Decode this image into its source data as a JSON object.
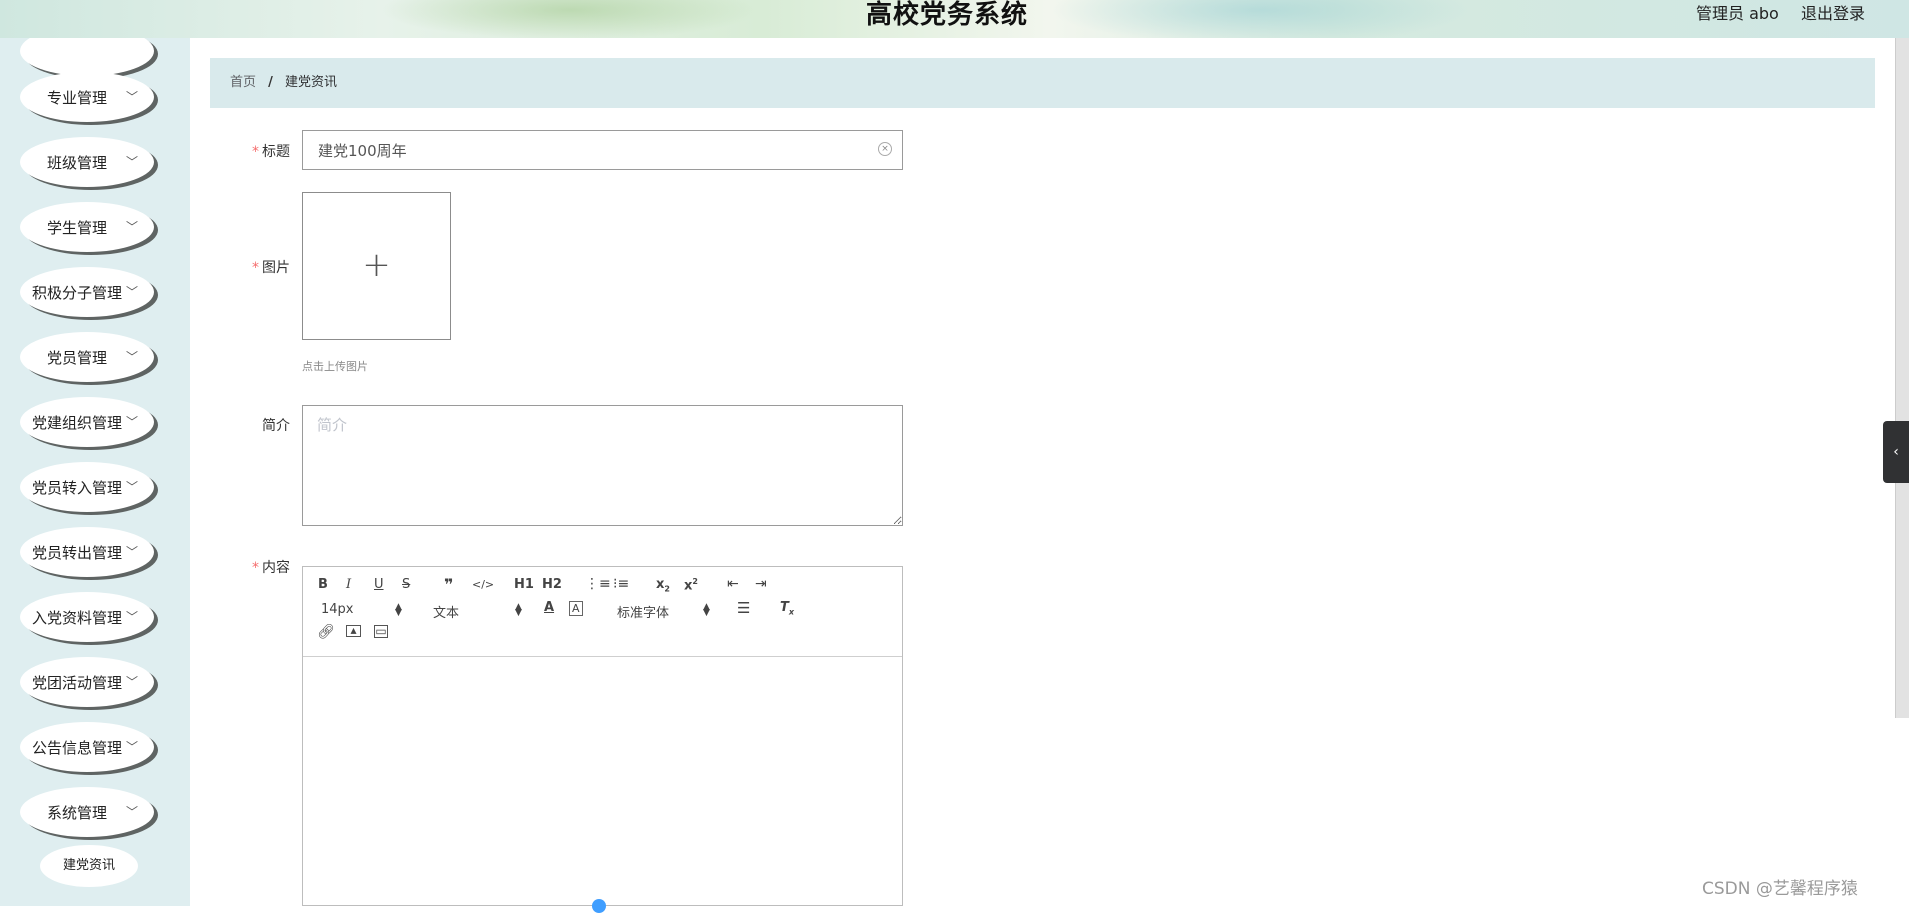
{
  "header": {
    "title": "高校党务系统",
    "user": "管理员 abo",
    "logout": "退出登录"
  },
  "sidebar": {
    "items": [
      {
        "label": "专业管理",
        "chevron": true
      },
      {
        "label": "班级管理",
        "chevron": true
      },
      {
        "label": "学生管理",
        "chevron": true
      },
      {
        "label": "积极分子管理",
        "chevron": true
      },
      {
        "label": "党员管理",
        "chevron": true
      },
      {
        "label": "党建组织管理",
        "chevron": true
      },
      {
        "label": "党员转入管理",
        "chevron": true
      },
      {
        "label": "党员转出管理",
        "chevron": true
      },
      {
        "label": "入党资料管理",
        "chevron": true
      },
      {
        "label": "党团活动管理",
        "chevron": true
      },
      {
        "label": "公告信息管理",
        "chevron": true
      },
      {
        "label": "系统管理",
        "chevron": true
      }
    ],
    "submenu_active": "建党资讯"
  },
  "breadcrumb": {
    "home": "首页",
    "separator": "/",
    "current": "建党资讯"
  },
  "form": {
    "title_label": "标题",
    "title_value": "建党100周年",
    "image_label": "图片",
    "upload_tip": "点击上传图片",
    "intro_label": "简介",
    "intro_placeholder": "简介",
    "content_label": "内容"
  },
  "editor": {
    "font_size": "14px",
    "header_select": "文本",
    "font_family": "标准字体",
    "h1": "H1",
    "h2": "H2"
  },
  "watermark": "CSDN @艺馨程序猿",
  "icons": {
    "bold": "bold-icon",
    "italic": "italic-icon",
    "underline": "underline-icon",
    "strike": "strikethrough-icon",
    "quote": "blockquote-icon",
    "code": "code-icon",
    "ordered_list": "ordered-list-icon",
    "bullet_list": "bullet-list-icon",
    "subscript": "subscript-icon",
    "superscript": "superscript-icon",
    "outdent": "outdent-icon",
    "indent": "indent-icon",
    "font_color": "font-color-icon",
    "background_color": "background-color-icon",
    "align": "align-icon",
    "clear_format": "clear-format-icon",
    "link": "link-icon",
    "image": "image-icon",
    "video": "video-icon"
  },
  "colors": {
    "sidebar_bg": "#dfeef0",
    "breadcrumb_bg": "#d9eaec",
    "required": "#f56c6c"
  }
}
